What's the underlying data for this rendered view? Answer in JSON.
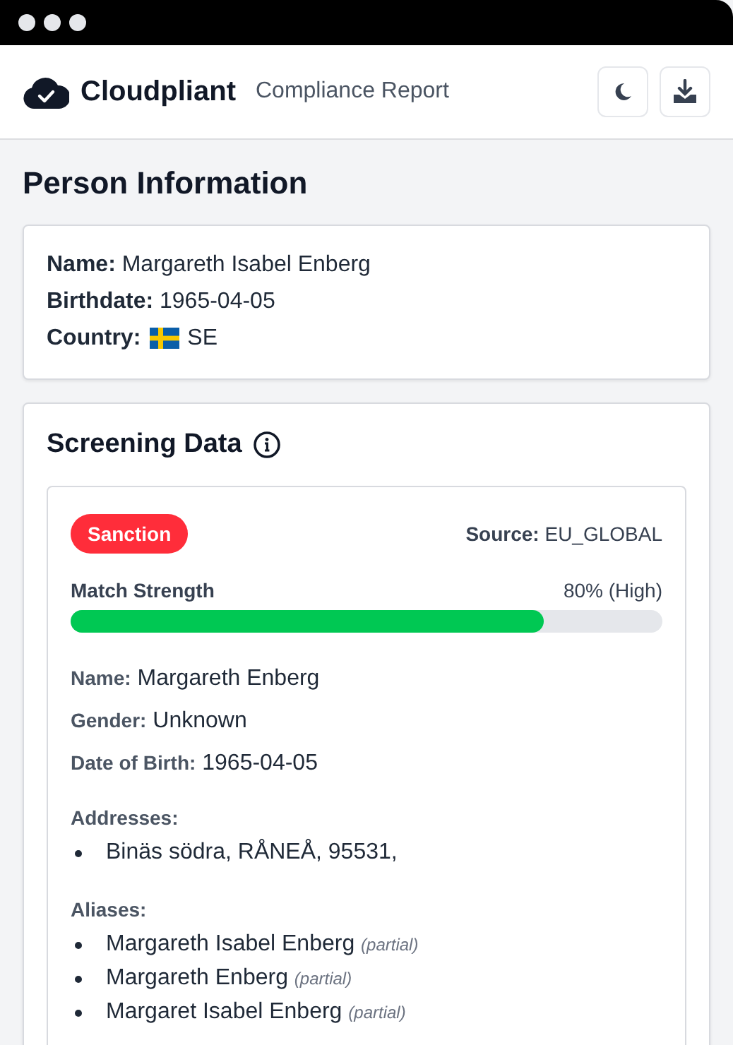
{
  "header": {
    "brand": "Cloudpliant",
    "subtitle": "Compliance Report"
  },
  "person": {
    "title": "Person Information",
    "fields": [
      {
        "kind": "text",
        "text": "**Name:** Margareth Isabel Enberg"
      },
      {
        "kind": "text",
        "text": "**Birthdate:** 1965-04-05"
      },
      {
        "kind": "country",
        "label": "Country:",
        "value": "SE"
      }
    ]
  },
  "screening": {
    "title": "Screening Data",
    "matches": [
      {
        "badge": "Sanction",
        "source": "**Source:** EU_GLOBAL",
        "strength_label": "Match Strength",
        "strength_reading": "80% (High)",
        "level": 0.8,
        "fields": [
          "**Name:** Margareth Enberg",
          "**Gender:** Unknown",
          "**Date of Birth:** 1965-04-05"
        ],
        "addresses_title": "Addresses:",
        "addresses": [
          "Binäs södra, RÅNEÅ, 95531,"
        ],
        "aliases_title": "Aliases:",
        "aliases": [
          "Margareth Isabel Enberg *(partial)*",
          "Margareth Enberg *(partial)*",
          "Margaret Isabel Enberg *(partial)*"
        ]
      }
    ]
  }
}
